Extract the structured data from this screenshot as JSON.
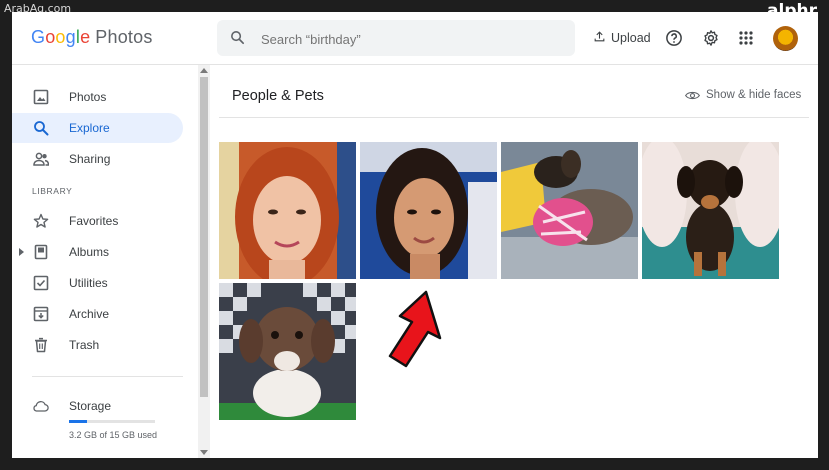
{
  "watermark": "ArabAq.com",
  "brand": "alphr",
  "header": {
    "logo_google": [
      "G",
      "o",
      "o",
      "g",
      "l",
      "e"
    ],
    "logo_product": "Photos",
    "search_placeholder": "Search “birthday”",
    "upload_label": "Upload",
    "icons": [
      "help-icon",
      "settings-icon",
      "apps-grid-icon",
      "avatar"
    ]
  },
  "sidebar": {
    "items": [
      {
        "label": "Photos",
        "icon": "photo-icon"
      },
      {
        "label": "Explore",
        "icon": "search-icon",
        "active": true
      },
      {
        "label": "Sharing",
        "icon": "people-icon"
      }
    ],
    "library_heading": "LIBRARY",
    "library_items": [
      {
        "label": "Favorites",
        "icon": "star-icon"
      },
      {
        "label": "Albums",
        "icon": "album-icon"
      },
      {
        "label": "Utilities",
        "icon": "checkbox-icon"
      },
      {
        "label": "Archive",
        "icon": "archive-icon"
      },
      {
        "label": "Trash",
        "icon": "trash-icon"
      }
    ],
    "storage": {
      "label": "Storage",
      "used_text": "3.2 GB of 15 GB used",
      "fraction": 0.213
    }
  },
  "main": {
    "title": "People & Pets",
    "show_hide": "Show & hide faces"
  },
  "colors": {
    "accent": "#1a73e8",
    "active_bg": "#e8f0fe",
    "arrow": "#e8141b"
  }
}
